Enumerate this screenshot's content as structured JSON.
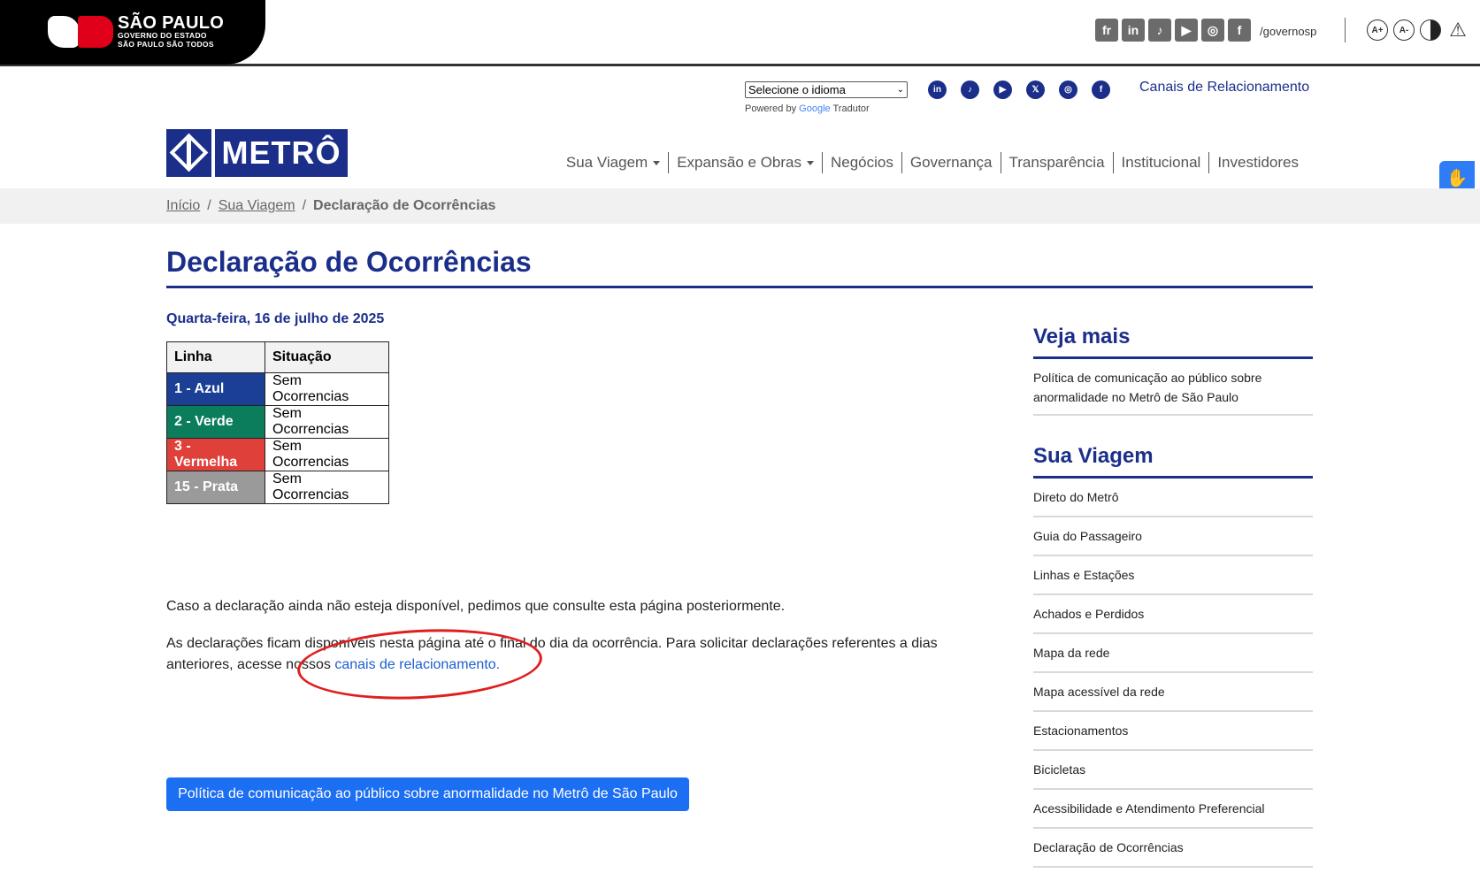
{
  "gov": {
    "title": "SÃO PAULO",
    "subtitle1": "GOVERNO DO ESTADO",
    "subtitle2": "SÃO PAULO SÃO TODOS",
    "social": [
      "fr",
      "in",
      "♪",
      "▶",
      "◎",
      "f"
    ],
    "handle": "/governosp",
    "a11y": [
      "A+",
      "A-"
    ]
  },
  "utility": {
    "language_select": "Selecione o idioma",
    "powered_prefix": "Powered by",
    "powered_brand": "Google",
    "powered_suffix": "Tradutor",
    "social_icons": [
      "in",
      "♪",
      "▶",
      "𝕏",
      "◎",
      "f"
    ],
    "canais_link": "Canais de Relacionamento"
  },
  "logo": {
    "name": "METRÔ"
  },
  "nav": {
    "items": [
      {
        "label": "Sua Viagem",
        "dropdown": true
      },
      {
        "label": "Expansão e Obras",
        "dropdown": true
      },
      {
        "label": "Negócios"
      },
      {
        "label": "Governança"
      },
      {
        "label": "Transparência"
      },
      {
        "label": "Institucional"
      },
      {
        "label": "Investidores"
      }
    ]
  },
  "breadcrumb": {
    "home": "Início",
    "sep": "/",
    "section": "Sua Viagem",
    "current": "Declaração de Ocorrências"
  },
  "page": {
    "title": "Declaração de Ocorrências",
    "date": "Quarta-feira, 16 de julho de 2025",
    "table": {
      "headers": [
        "Linha",
        "Situação"
      ],
      "rows": [
        {
          "line": "1 - Azul",
          "status": "Sem Ocorrencias",
          "color": "#1b3f95"
        },
        {
          "line": "2 - Verde",
          "status": "Sem Ocorrencias",
          "color": "#0b7d5d"
        },
        {
          "line": "3 - Vermelha",
          "status": "Sem Ocorrencias",
          "color": "#e0403a"
        },
        {
          "line": "15 - Prata",
          "status": "Sem Ocorrencias",
          "color": "#9a9a9a"
        }
      ]
    },
    "note1": "Caso a declaração ainda não esteja disponível, pedimos que consulte esta página posteriormente.",
    "note2_text": "As declarações ficam disponíveis nesta página até o final do dia da ocorrência. Para solicitar declarações referentes a dias anteriores, acesse nossos ",
    "note2_link": "canais de relacionamento.",
    "policy_button": "Política de comunicação ao público sobre anormalidade no Metrô de São Paulo"
  },
  "sidebar": {
    "veja_mais": {
      "title": "Veja mais",
      "links": [
        "Política de comunicação ao público sobre anormalidade no Metrô de São Paulo"
      ]
    },
    "sua_viagem": {
      "title": "Sua Viagem",
      "links": [
        "Direto do Metrô",
        "Guia do Passageiro",
        "Linhas e Estações",
        "Achados e Perdidos",
        "Mapa da rede",
        "Mapa acessível da rede",
        "Estacionamentos",
        "Bicicletas",
        "Acessibilidade e Atendimento Preferencial",
        "Declaração de Ocorrências"
      ]
    }
  },
  "colors": {
    "brand": "#1b2f8a",
    "button": "#1c6ef2",
    "annotation": "#e01f1f"
  }
}
